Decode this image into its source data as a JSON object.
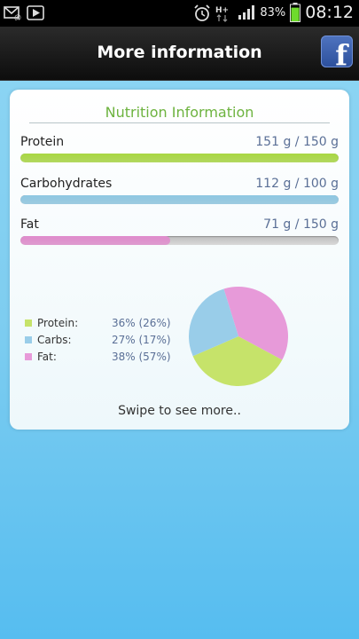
{
  "status_bar": {
    "icons_left": [
      "mail-icon",
      "play-icon"
    ],
    "icons_right": [
      "alarm-icon",
      "hplus-network-icon",
      "signal-icon",
      "battery-icon"
    ],
    "battery": "83%",
    "battery_level": 0.83,
    "time": "08:12"
  },
  "header": {
    "title": "More information",
    "facebook_glyph": "f"
  },
  "card": {
    "title": "Nutrition Information",
    "nutrients": [
      {
        "label": "Protein",
        "value": "151 g / 150 g",
        "fill": 1.0,
        "color": "#a9d843"
      },
      {
        "label": "Carbohydrates",
        "value": "112 g / 100 g",
        "fill": 1.0,
        "color": "#8fc8e3"
      },
      {
        "label": "Fat",
        "value": "71 g / 150 g",
        "fill": 0.47,
        "color": "#e08ccd"
      }
    ],
    "legend": [
      {
        "name": "Protein:",
        "pct": "36% (26%)",
        "color": "#c6e36a"
      },
      {
        "name": "Carbs:",
        "pct": "27% (17%)",
        "color": "#99cde9"
      },
      {
        "name": "Fat:",
        "pct": "38% (57%)",
        "color": "#e79ad9"
      }
    ],
    "swipe_hint": "Swipe to see more.."
  },
  "chart_data": {
    "type": "pie",
    "categories": [
      "Protein",
      "Carbs",
      "Fat"
    ],
    "values": [
      36,
      27,
      38
    ],
    "colors": [
      "#c6e36a",
      "#99cde9",
      "#e79ad9"
    ]
  }
}
